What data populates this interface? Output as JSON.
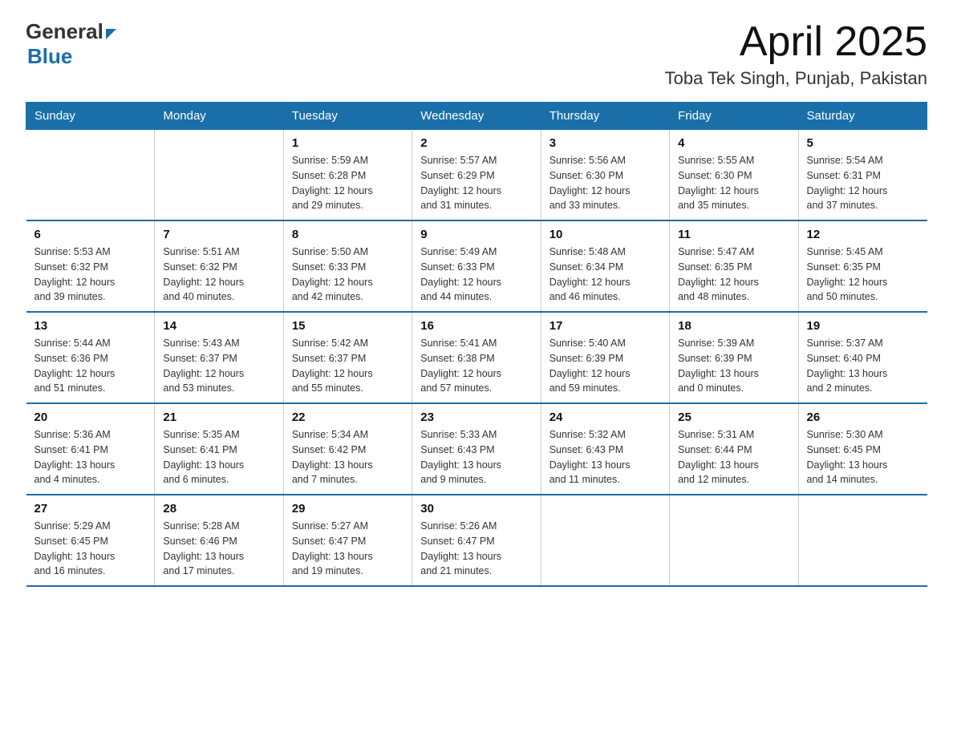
{
  "header": {
    "logo_general": "General",
    "logo_triangle": "▶",
    "logo_blue": "Blue",
    "month_title": "April 2025",
    "location": "Toba Tek Singh, Punjab, Pakistan"
  },
  "days_of_week": [
    "Sunday",
    "Monday",
    "Tuesday",
    "Wednesday",
    "Thursday",
    "Friday",
    "Saturday"
  ],
  "weeks": [
    [
      {
        "day": "",
        "info": ""
      },
      {
        "day": "",
        "info": ""
      },
      {
        "day": "1",
        "info": "Sunrise: 5:59 AM\nSunset: 6:28 PM\nDaylight: 12 hours\nand 29 minutes."
      },
      {
        "day": "2",
        "info": "Sunrise: 5:57 AM\nSunset: 6:29 PM\nDaylight: 12 hours\nand 31 minutes."
      },
      {
        "day": "3",
        "info": "Sunrise: 5:56 AM\nSunset: 6:30 PM\nDaylight: 12 hours\nand 33 minutes."
      },
      {
        "day": "4",
        "info": "Sunrise: 5:55 AM\nSunset: 6:30 PM\nDaylight: 12 hours\nand 35 minutes."
      },
      {
        "day": "5",
        "info": "Sunrise: 5:54 AM\nSunset: 6:31 PM\nDaylight: 12 hours\nand 37 minutes."
      }
    ],
    [
      {
        "day": "6",
        "info": "Sunrise: 5:53 AM\nSunset: 6:32 PM\nDaylight: 12 hours\nand 39 minutes."
      },
      {
        "day": "7",
        "info": "Sunrise: 5:51 AM\nSunset: 6:32 PM\nDaylight: 12 hours\nand 40 minutes."
      },
      {
        "day": "8",
        "info": "Sunrise: 5:50 AM\nSunset: 6:33 PM\nDaylight: 12 hours\nand 42 minutes."
      },
      {
        "day": "9",
        "info": "Sunrise: 5:49 AM\nSunset: 6:33 PM\nDaylight: 12 hours\nand 44 minutes."
      },
      {
        "day": "10",
        "info": "Sunrise: 5:48 AM\nSunset: 6:34 PM\nDaylight: 12 hours\nand 46 minutes."
      },
      {
        "day": "11",
        "info": "Sunrise: 5:47 AM\nSunset: 6:35 PM\nDaylight: 12 hours\nand 48 minutes."
      },
      {
        "day": "12",
        "info": "Sunrise: 5:45 AM\nSunset: 6:35 PM\nDaylight: 12 hours\nand 50 minutes."
      }
    ],
    [
      {
        "day": "13",
        "info": "Sunrise: 5:44 AM\nSunset: 6:36 PM\nDaylight: 12 hours\nand 51 minutes."
      },
      {
        "day": "14",
        "info": "Sunrise: 5:43 AM\nSunset: 6:37 PM\nDaylight: 12 hours\nand 53 minutes."
      },
      {
        "day": "15",
        "info": "Sunrise: 5:42 AM\nSunset: 6:37 PM\nDaylight: 12 hours\nand 55 minutes."
      },
      {
        "day": "16",
        "info": "Sunrise: 5:41 AM\nSunset: 6:38 PM\nDaylight: 12 hours\nand 57 minutes."
      },
      {
        "day": "17",
        "info": "Sunrise: 5:40 AM\nSunset: 6:39 PM\nDaylight: 12 hours\nand 59 minutes."
      },
      {
        "day": "18",
        "info": "Sunrise: 5:39 AM\nSunset: 6:39 PM\nDaylight: 13 hours\nand 0 minutes."
      },
      {
        "day": "19",
        "info": "Sunrise: 5:37 AM\nSunset: 6:40 PM\nDaylight: 13 hours\nand 2 minutes."
      }
    ],
    [
      {
        "day": "20",
        "info": "Sunrise: 5:36 AM\nSunset: 6:41 PM\nDaylight: 13 hours\nand 4 minutes."
      },
      {
        "day": "21",
        "info": "Sunrise: 5:35 AM\nSunset: 6:41 PM\nDaylight: 13 hours\nand 6 minutes."
      },
      {
        "day": "22",
        "info": "Sunrise: 5:34 AM\nSunset: 6:42 PM\nDaylight: 13 hours\nand 7 minutes."
      },
      {
        "day": "23",
        "info": "Sunrise: 5:33 AM\nSunset: 6:43 PM\nDaylight: 13 hours\nand 9 minutes."
      },
      {
        "day": "24",
        "info": "Sunrise: 5:32 AM\nSunset: 6:43 PM\nDaylight: 13 hours\nand 11 minutes."
      },
      {
        "day": "25",
        "info": "Sunrise: 5:31 AM\nSunset: 6:44 PM\nDaylight: 13 hours\nand 12 minutes."
      },
      {
        "day": "26",
        "info": "Sunrise: 5:30 AM\nSunset: 6:45 PM\nDaylight: 13 hours\nand 14 minutes."
      }
    ],
    [
      {
        "day": "27",
        "info": "Sunrise: 5:29 AM\nSunset: 6:45 PM\nDaylight: 13 hours\nand 16 minutes."
      },
      {
        "day": "28",
        "info": "Sunrise: 5:28 AM\nSunset: 6:46 PM\nDaylight: 13 hours\nand 17 minutes."
      },
      {
        "day": "29",
        "info": "Sunrise: 5:27 AM\nSunset: 6:47 PM\nDaylight: 13 hours\nand 19 minutes."
      },
      {
        "day": "30",
        "info": "Sunrise: 5:26 AM\nSunset: 6:47 PM\nDaylight: 13 hours\nand 21 minutes."
      },
      {
        "day": "",
        "info": ""
      },
      {
        "day": "",
        "info": ""
      },
      {
        "day": "",
        "info": ""
      }
    ]
  ]
}
